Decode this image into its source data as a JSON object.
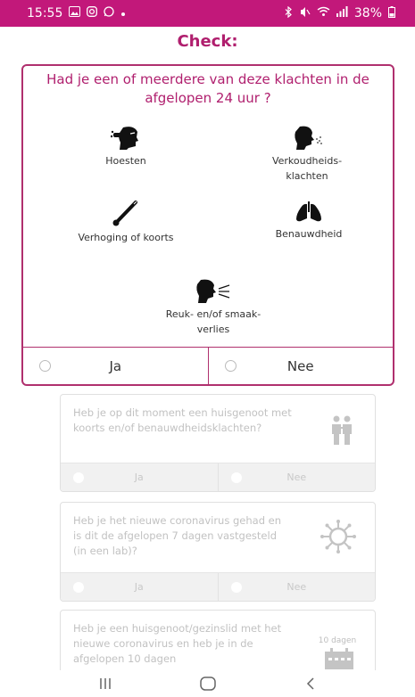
{
  "status_bar": {
    "time": "15:55",
    "battery": "38%",
    "left_icons": [
      "image-icon",
      "instagram-icon",
      "whatsapp-icon",
      "dot-icon"
    ],
    "right_icons": [
      "bluetooth-icon",
      "mute-icon",
      "wifi-icon",
      "signal-icon",
      "battery-icon"
    ]
  },
  "page": {
    "title": "Check:"
  },
  "main_question": {
    "text": "Had je een of meerdere van deze klachten in de afgelopen 24 uur ?",
    "symptoms": [
      {
        "label": "Hoesten",
        "icon": "cough-icon"
      },
      {
        "label": "Verkoudheids-klachten",
        "icon": "sneeze-icon"
      },
      {
        "label": "Verhoging of koorts",
        "icon": "thermometer-icon"
      },
      {
        "label": "Benauwdheid",
        "icon": "lungs-icon"
      },
      {
        "label": "Reuk- en/of smaak-verlies",
        "icon": "smell-loss-icon"
      }
    ],
    "answers": {
      "yes": "Ja",
      "no": "Nee"
    }
  },
  "questions": [
    {
      "text": "Heb je op dit moment een huisgenoot met koorts en/of benauwdheidsklachten?",
      "icon": "household-icon",
      "yes": "Ja",
      "no": "Nee"
    },
    {
      "text": "Heb je het nieuwe coronavirus gehad en is dit de afgelopen 7 dagen vastgesteld (in een lab)?",
      "icon": "virus-icon",
      "yes": "Ja",
      "no": "Nee"
    },
    {
      "text": "Heb je een huisgenoot/gezinslid met het nieuwe coronavirus en heb je in de afgelopen 10 dagen",
      "icon": "calendar-icon",
      "tag": "10 dagen"
    }
  ],
  "nav": {
    "buttons": [
      "recents-icon",
      "home-icon",
      "back-icon"
    ]
  },
  "colors": {
    "brand": "#c2187a",
    "accent_text": "#b01f6e",
    "border": "#b0306e",
    "dim_text": "#c2c2c2"
  }
}
